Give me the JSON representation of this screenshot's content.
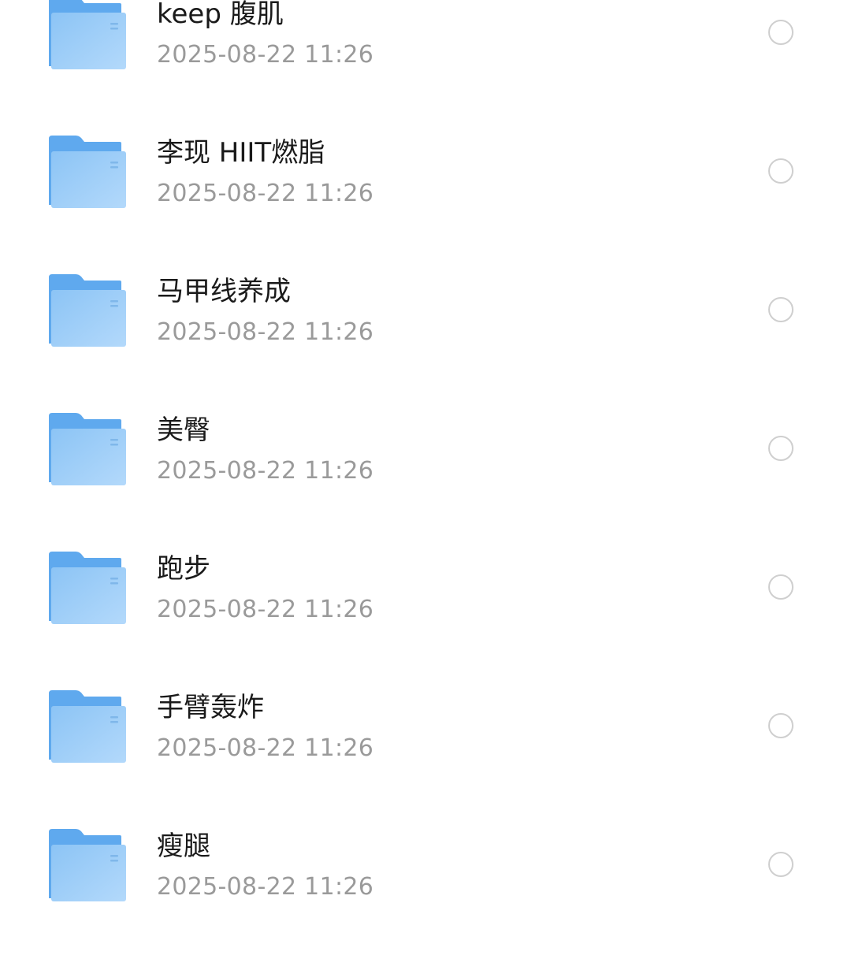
{
  "colors": {
    "folder_tab": "#5fa9ee",
    "folder_front_top": "#8cc4f5",
    "folder_front_bottom": "#b3d9fb",
    "name_text": "#1a1a1a",
    "date_text": "#9a9a9a",
    "radio_border": "#cfcfcf"
  },
  "files": [
    {
      "icon": "folder-icon",
      "name": "keep 腹肌",
      "modified": "2025-08-22 11:26",
      "selected": false
    },
    {
      "icon": "folder-icon",
      "name": "李现 HIIT燃脂",
      "modified": "2025-08-22 11:26",
      "selected": false
    },
    {
      "icon": "folder-icon",
      "name": "马甲线养成",
      "modified": "2025-08-22 11:26",
      "selected": false
    },
    {
      "icon": "folder-icon",
      "name": "美臀",
      "modified": "2025-08-22 11:26",
      "selected": false
    },
    {
      "icon": "folder-icon",
      "name": "跑步",
      "modified": "2025-08-22 11:26",
      "selected": false
    },
    {
      "icon": "folder-icon",
      "name": "手臂轰炸",
      "modified": "2025-08-22 11:26",
      "selected": false
    },
    {
      "icon": "folder-icon",
      "name": "瘦腿",
      "modified": "2025-08-22 11:26",
      "selected": false
    }
  ]
}
